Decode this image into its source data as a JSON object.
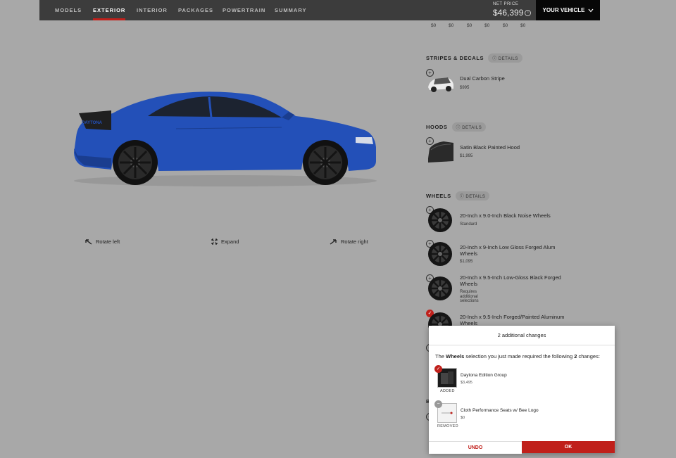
{
  "nav": {
    "tabs": [
      {
        "label": "MODELS"
      },
      {
        "label": "EXTERIOR"
      },
      {
        "label": "INTERIOR"
      },
      {
        "label": "PACKAGES"
      },
      {
        "label": "POWERTRAIN"
      },
      {
        "label": "SUMMARY"
      }
    ],
    "net_price_label": "NET PRICE",
    "net_price": "$46,399",
    "your_vehicle": "YOUR VEHICLE"
  },
  "top_prices": [
    "$0",
    "$0",
    "$0",
    "$0",
    "$0",
    "$0"
  ],
  "sections": {
    "stripes": {
      "title": "STRIPES & DECALS",
      "details": "DETAILS",
      "options": [
        {
          "name": "Dual Carbon Stripe",
          "price": "$995"
        }
      ]
    },
    "hoods": {
      "title": "HOODS",
      "details": "DETAILS",
      "options": [
        {
          "name": "Satin Black Painted Hood",
          "price": "$1,995"
        }
      ]
    },
    "wheels": {
      "title": "WHEELS",
      "details": "DETAILS",
      "options": [
        {
          "name": "20-Inch x 9.0-Inch Black Noise Wheels",
          "sub": "Standard"
        },
        {
          "name": "20-Inch x 9-Inch Low Gloss Forged Alum Wheels",
          "sub": "$1,095"
        },
        {
          "name": "20-Inch x 9.5-Inch Low-Gloss Black Forged Wheels",
          "sub": "Requires additional selections"
        },
        {
          "name": "20-Inch x 9.5-Inch Forged/Painted Aluminum Wheels",
          "sub": ""
        }
      ]
    },
    "partial_header": "B"
  },
  "viewer": {
    "rotate_left": "Rotate left",
    "expand": "Expand",
    "rotate_right": "Rotate right",
    "car_badge": "DAYTONA"
  },
  "modal": {
    "title": "2 additional changes",
    "message_prefix": "The ",
    "message_bold": "Wheels",
    "message_mid": " selection you just made required the following ",
    "message_count": "2",
    "message_suffix": " changes:",
    "changes": [
      {
        "name": "Daytona Edition Group",
        "price": "$3,495",
        "status": "ADDED"
      },
      {
        "name": "Cloth Performance Seats w/ Bee Logo",
        "price": "$0",
        "status": "REMOVED"
      }
    ],
    "undo": "UNDO",
    "ok": "OK"
  },
  "colors": {
    "accent": "#c0201b",
    "car_blue": "#2350b8",
    "nav_bg": "#3c3c3c",
    "page_bg": "#a8a8a8"
  }
}
